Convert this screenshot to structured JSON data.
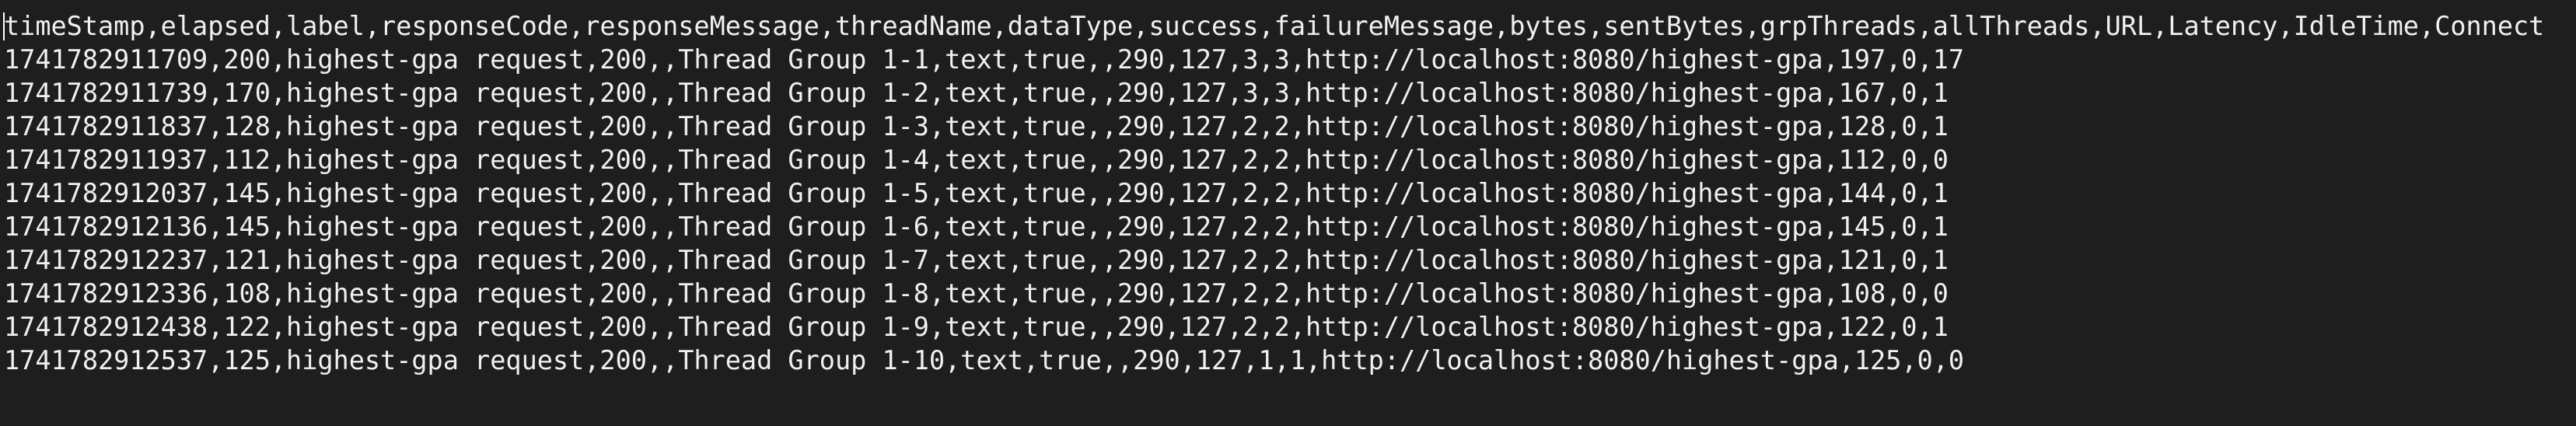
{
  "file": {
    "lines": [
      "timeStamp,elapsed,label,responseCode,responseMessage,threadName,dataType,success,failureMessage,bytes,sentBytes,grpThreads,allThreads,URL,Latency,IdleTime,Connect",
      "1741782911709,200,highest-gpa request,200,,Thread Group 1-1,text,true,,290,127,3,3,http://localhost:8080/highest-gpa,197,0,17",
      "1741782911739,170,highest-gpa request,200,,Thread Group 1-2,text,true,,290,127,3,3,http://localhost:8080/highest-gpa,167,0,1",
      "1741782911837,128,highest-gpa request,200,,Thread Group 1-3,text,true,,290,127,2,2,http://localhost:8080/highest-gpa,128,0,1",
      "1741782911937,112,highest-gpa request,200,,Thread Group 1-4,text,true,,290,127,2,2,http://localhost:8080/highest-gpa,112,0,0",
      "1741782912037,145,highest-gpa request,200,,Thread Group 1-5,text,true,,290,127,2,2,http://localhost:8080/highest-gpa,144,0,1",
      "1741782912136,145,highest-gpa request,200,,Thread Group 1-6,text,true,,290,127,2,2,http://localhost:8080/highest-gpa,145,0,1",
      "1741782912237,121,highest-gpa request,200,,Thread Group 1-7,text,true,,290,127,2,2,http://localhost:8080/highest-gpa,121,0,1",
      "1741782912336,108,highest-gpa request,200,,Thread Group 1-8,text,true,,290,127,2,2,http://localhost:8080/highest-gpa,108,0,0",
      "1741782912438,122,highest-gpa request,200,,Thread Group 1-9,text,true,,290,127,2,2,http://localhost:8080/highest-gpa,122,0,1",
      "1741782912537,125,highest-gpa request,200,,Thread Group 1-10,text,true,,290,127,1,1,http://localhost:8080/highest-gpa,125,0,0"
    ]
  },
  "colors": {
    "background": "#1e1e1e",
    "text": "#f0f0f0",
    "caret": "#ffffff"
  }
}
